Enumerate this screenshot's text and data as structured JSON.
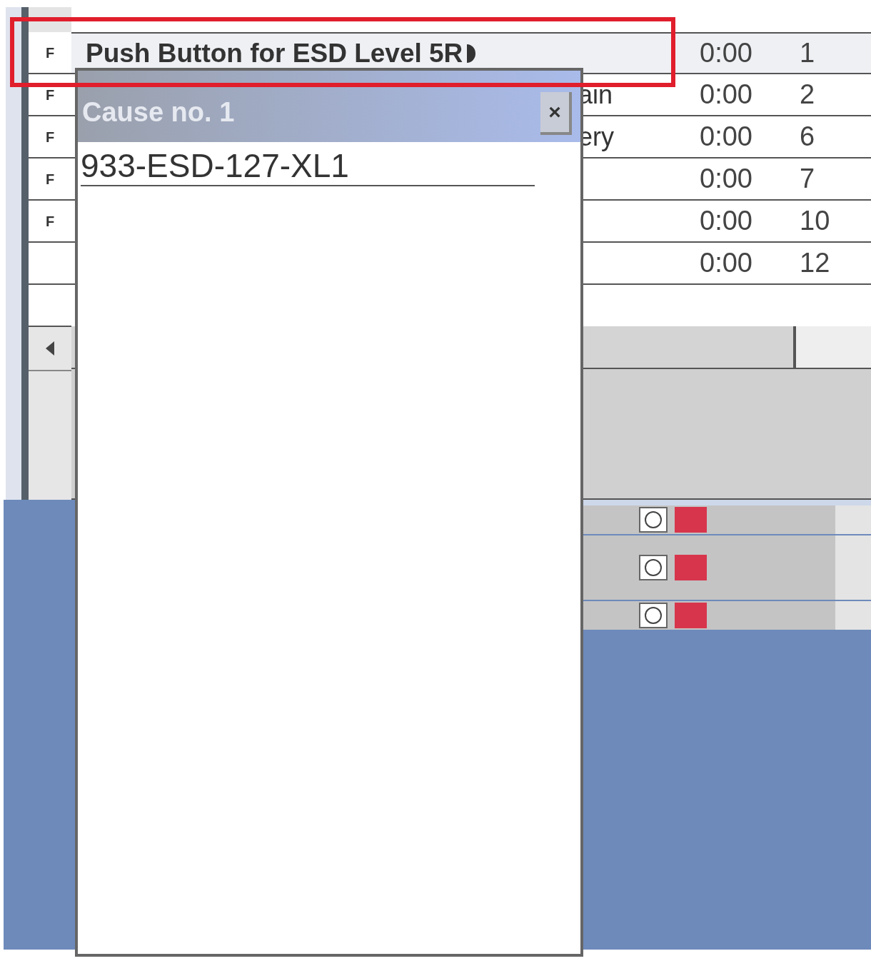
{
  "table": {
    "rows": [
      {
        "flag": "F",
        "name": "Push Button for ESD Level 5R",
        "time": "0:00",
        "number": "1",
        "highlighted": true
      },
      {
        "flag": "F",
        "name": "ain",
        "time": "0:00",
        "number": "2",
        "highlighted": false
      },
      {
        "flag": "F",
        "name": "ery",
        "time": "0:00",
        "number": "6",
        "highlighted": false
      },
      {
        "flag": "F",
        "time": "0:00",
        "number": "7",
        "highlighted": false
      },
      {
        "flag": "F",
        "time": "0:00",
        "number": "10",
        "highlighted": false
      },
      {
        "time": "0:00",
        "number": "12",
        "highlighted": false
      }
    ]
  },
  "popup": {
    "title": "Cause no. 1",
    "close": "×",
    "value": "933-ESD-127-XL1"
  }
}
